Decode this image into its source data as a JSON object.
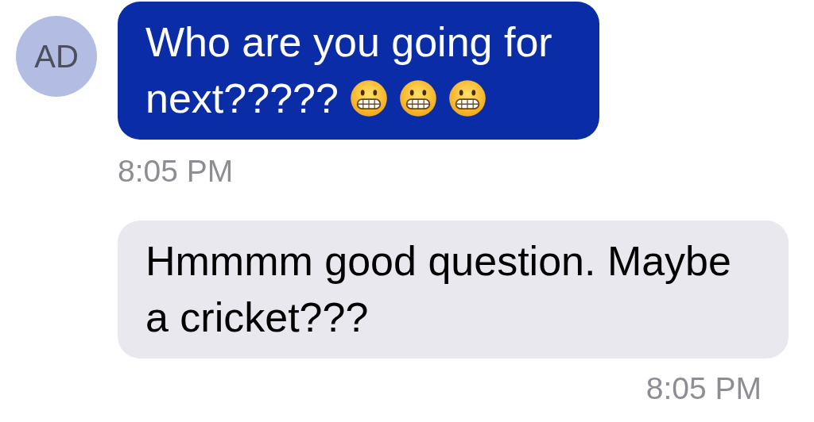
{
  "messages": [
    {
      "kind": "incoming",
      "avatar": "AD",
      "text": "Who are you going for next?????",
      "emojis": [
        {
          "kind": "grimacing"
        },
        {
          "kind": "grimacing"
        },
        {
          "kind": "grimacing"
        }
      ],
      "time": "8:05 PM"
    },
    {
      "kind": "outgoing",
      "text": "Hmmmm good question. Maybe a cricket???",
      "time": "8:05 PM"
    }
  ]
}
